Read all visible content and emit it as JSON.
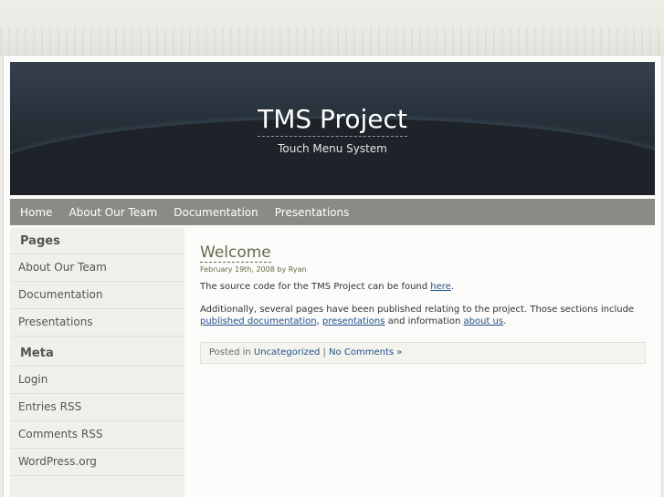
{
  "header": {
    "title": "TMS Project",
    "tagline": "Touch Menu System"
  },
  "nav": {
    "items": [
      "Home",
      "About Our Team",
      "Documentation",
      "Presentations"
    ]
  },
  "sidebar": {
    "pages_heading": "Pages",
    "pages": [
      "About Our Team",
      "Documentation",
      "Presentations"
    ],
    "meta_heading": "Meta",
    "meta": [
      "Login",
      "Entries RSS",
      "Comments RSS",
      "WordPress.org"
    ]
  },
  "post": {
    "title": "Welcome",
    "meta": "February 19th, 2008 by Ryan",
    "p1_text": "The source code for the TMS Project can be found ",
    "p1_link": "here",
    "p1_end": ".",
    "p2_text": "Additionally, several pages have been published relating to the project. Those sections include ",
    "p2_link1": "published documentation",
    "p2_sep": ", ",
    "p2_link2": "presentations",
    "p2_mid": " and information ",
    "p2_link3": "about us",
    "p2_end": ".",
    "footer_prefix": "Posted in ",
    "footer_category": "Uncategorized",
    "footer_sep": " | ",
    "footer_comments": "No Comments »"
  }
}
